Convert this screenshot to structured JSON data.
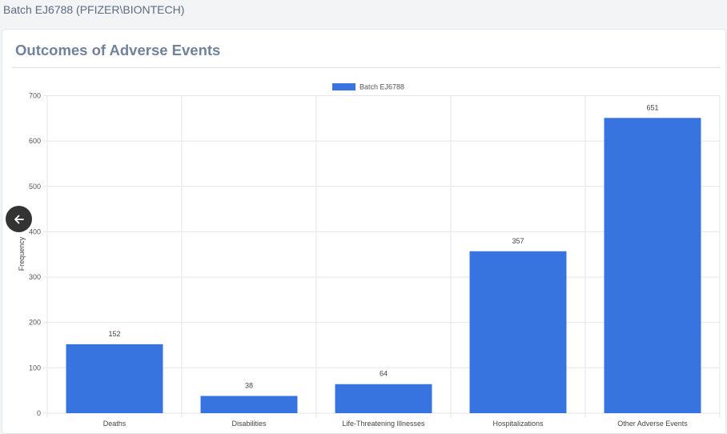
{
  "page": {
    "batch_title": "Batch EJ6788 (PFIZER\\BIONTECH)"
  },
  "card": {
    "title": "Outcomes of Adverse Events"
  },
  "colors": {
    "bar": "#3874df",
    "grid": "#e6e6e6",
    "back_button": "#333333"
  },
  "back_button": {
    "icon": "arrow-left-icon"
  },
  "chart_data": {
    "type": "bar",
    "categories": [
      "Deaths",
      "Disabilities",
      "Life-Threatening Illnesses",
      "Hospitalizations",
      "Other Adverse Events"
    ],
    "series": [
      {
        "name": "Batch EJ6788",
        "values": [
          152,
          38,
          64,
          357,
          651
        ]
      }
    ],
    "xlabel": "",
    "ylabel": "Frequency",
    "ylim": [
      0,
      700
    ],
    "yticks": [
      0,
      100,
      200,
      300,
      400,
      500,
      600,
      700
    ],
    "grid": true,
    "legend": "top-center",
    "data_labels": true
  }
}
